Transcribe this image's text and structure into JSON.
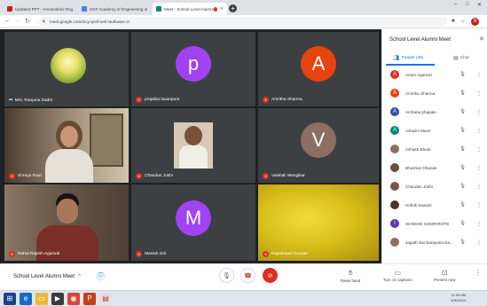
{
  "browser": {
    "tabs": [
      {
        "label": "Updated PPT - Amrutvahini Eng",
        "favicon_color": "#c5221f"
      },
      {
        "label": "SGT Academy of Engineering in",
        "favicon_color": "#4285f4"
      },
      {
        "label": "Meet - School Level Alumni",
        "favicon_color": "#00897b"
      }
    ],
    "url": "meet.google.com/mcy-qcef-nek?authuser=0"
  },
  "meeting": {
    "title": "School Level Alumni Meet",
    "tiles": [
      {
        "name": "Mrs. Ranjana Sadre",
        "kind": "photo"
      },
      {
        "name": "prajakta laxanpure",
        "kind": "avatar",
        "letter": "p",
        "color": "#a142f4"
      },
      {
        "name": "Amritha Sharma",
        "kind": "avatar",
        "letter": "A",
        "color": "#e8430f"
      },
      {
        "name": "Shreya Raut",
        "kind": "video"
      },
      {
        "name": "Chandan Joshi",
        "kind": "video"
      },
      {
        "name": "Vaishali Wangikar",
        "kind": "avatar",
        "letter": "V",
        "color": "#8d6e63"
      },
      {
        "name": "Rahul Rajesh Agarwal",
        "kind": "video"
      },
      {
        "name": "Manish Giri",
        "kind": "avatar",
        "letter": "M",
        "color": "#a142f4"
      },
      {
        "name": "Rajeshwari Goudar",
        "kind": "video"
      }
    ]
  },
  "panel": {
    "title": "School Level Alumni Meet",
    "people_tab": "People (48)",
    "chat_tab": "Chat",
    "people": [
      {
        "name": "Aman Agarwal",
        "letter": "A",
        "color": "#d93025"
      },
      {
        "name": "Amritha Sharma",
        "letter": "A",
        "color": "#e8430f"
      },
      {
        "name": "Archana phapale",
        "letter": "A",
        "color": "#3949ab"
      },
      {
        "name": "Ashwini Mane",
        "letter": "A",
        "color": "#00897b"
      },
      {
        "name": "Avhash Bhute",
        "letter": "",
        "color": "#8d6e63"
      },
      {
        "name": "Bhushan Dhande",
        "letter": "",
        "color": "#6d4c41"
      },
      {
        "name": "Chandan Joshi",
        "letter": "",
        "color": "#795548"
      },
      {
        "name": "Hrithik Sawant",
        "letter": "",
        "color": "#4e342e"
      },
      {
        "name": "ISHWARI SONPAROTE",
        "letter": "I",
        "color": "#5e35b1"
      },
      {
        "name": "Jagath Sai Narayana Na...",
        "letter": "",
        "color": "#8d6e63"
      }
    ]
  },
  "bottombar": {
    "raise_hand": "Raise hand",
    "captions": "Turn on captions",
    "present": "Present now"
  },
  "taskbar": {
    "time": "11:09 AM",
    "date": "1/30/2021"
  }
}
